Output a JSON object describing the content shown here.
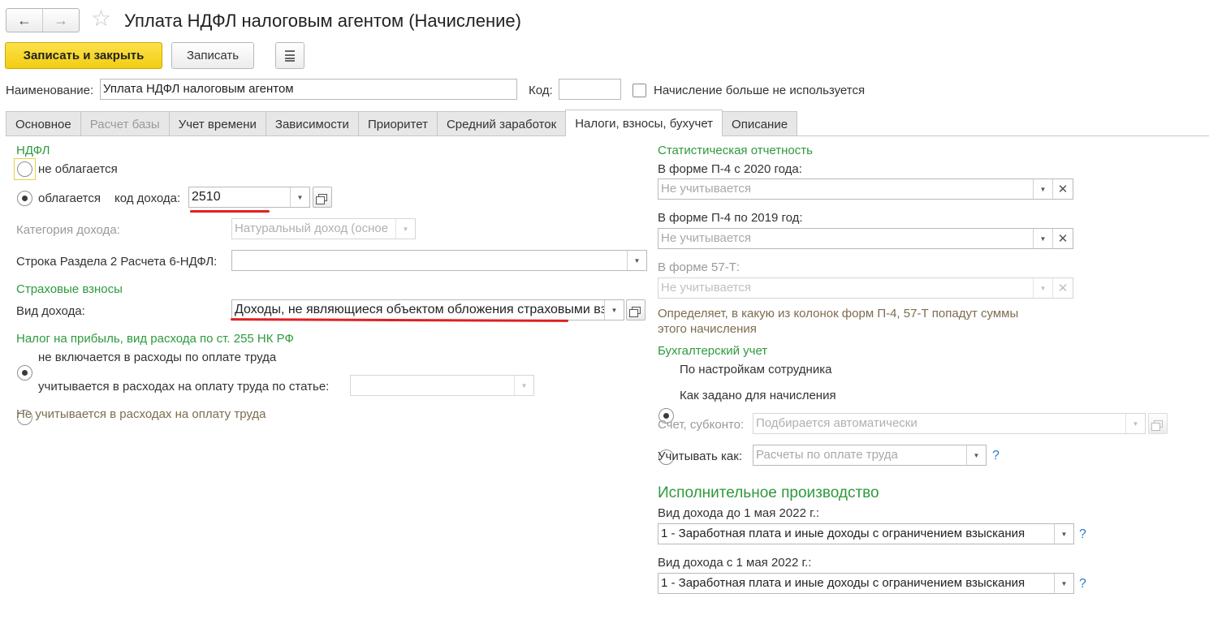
{
  "window": {
    "title": "Уплата НДФЛ налоговым агентом (Начисление)",
    "back_icon": "←",
    "forward_icon": "→",
    "star_icon": "☆"
  },
  "toolbar": {
    "save_close_label": "Записать и закрыть",
    "save_label": "Записать"
  },
  "header": {
    "name_label": "Наименование:",
    "name_value": "Уплата НДФЛ налоговым агентом",
    "code_label": "Код:",
    "code_value": "",
    "unused_label": "Начисление больше не используется"
  },
  "tabs": [
    {
      "label": "Основное"
    },
    {
      "label": "Расчет базы"
    },
    {
      "label": "Учет времени"
    },
    {
      "label": "Зависимости"
    },
    {
      "label": "Приоритет"
    },
    {
      "label": "Средний заработок"
    },
    {
      "label": "Налоги, взносы, бухучет"
    },
    {
      "label": "Описание"
    }
  ],
  "left": {
    "ndfl_section": "НДФЛ",
    "not_taxed_label": "не облагается",
    "taxed_label": "облагается",
    "income_code_label": "код дохода:",
    "income_code_value": "2510",
    "income_category_label": "Категория дохода:",
    "income_category_value": "Натуральный доход (осное",
    "report_line_label": "Строка Раздела 2 Расчета 6-НДФЛ:",
    "report_line_value": "",
    "insurance_section": "Страховые взносы",
    "income_type_label": "Вид дохода:",
    "income_type_value": "Доходы, не являющиеся объектом обложения страховыми взн",
    "profit_tax_section": "Налог на прибыль, вид расхода по ст. 255 НК РФ",
    "not_included_label": "не включается в расходы по оплате труда",
    "included_label": "учитывается в расходах на оплату труда по статье:",
    "article_value": "",
    "profit_hint": "Не учитывается в расходах на оплату труда"
  },
  "right": {
    "stats_section": "Статистическая отчетность",
    "p4_2020_label": "В форме П-4 с 2020 года:",
    "p4_2020_placeholder": "Не учитывается",
    "p4_2019_label": "В форме П-4 по 2019 год:",
    "p4_2019_placeholder": "Не учитывается",
    "f57t_label": "В форме 57-Т:",
    "f57t_placeholder": "Не учитывается",
    "stats_hint": "Определяет, в какую из колонок форм П-4, 57-Т попадут суммы этого начисления",
    "accounting_section": "Бухгалтерский учет",
    "by_employee_label": "По настройкам сотрудника",
    "as_accrual_label": "Как задано для начисления",
    "account_label": "Счет, субконто:",
    "account_placeholder": "Подбирается автоматически",
    "account_as_label": "Учитывать как:",
    "account_as_placeholder": "Расчеты по оплате труда",
    "enforcement_section": "Исполнительное производство",
    "before_may_label": "Вид дохода до 1 мая 2022 г.:",
    "before_may_value": "1 - Заработная плата и иные доходы с ограничением взыскания",
    "after_may_label": "Вид дохода с 1 мая 2022 г.:",
    "after_may_value": "1 - Заработная плата и иные доходы с ограничением взыскания",
    "help_mark": "?"
  },
  "colors": {
    "section_green": "#2e9a3c",
    "primary_yellow": "#f3cd13",
    "annotation_red": "#e02020",
    "hint_brown": "#7c6d4e",
    "help_blue": "#2a7ad0"
  }
}
